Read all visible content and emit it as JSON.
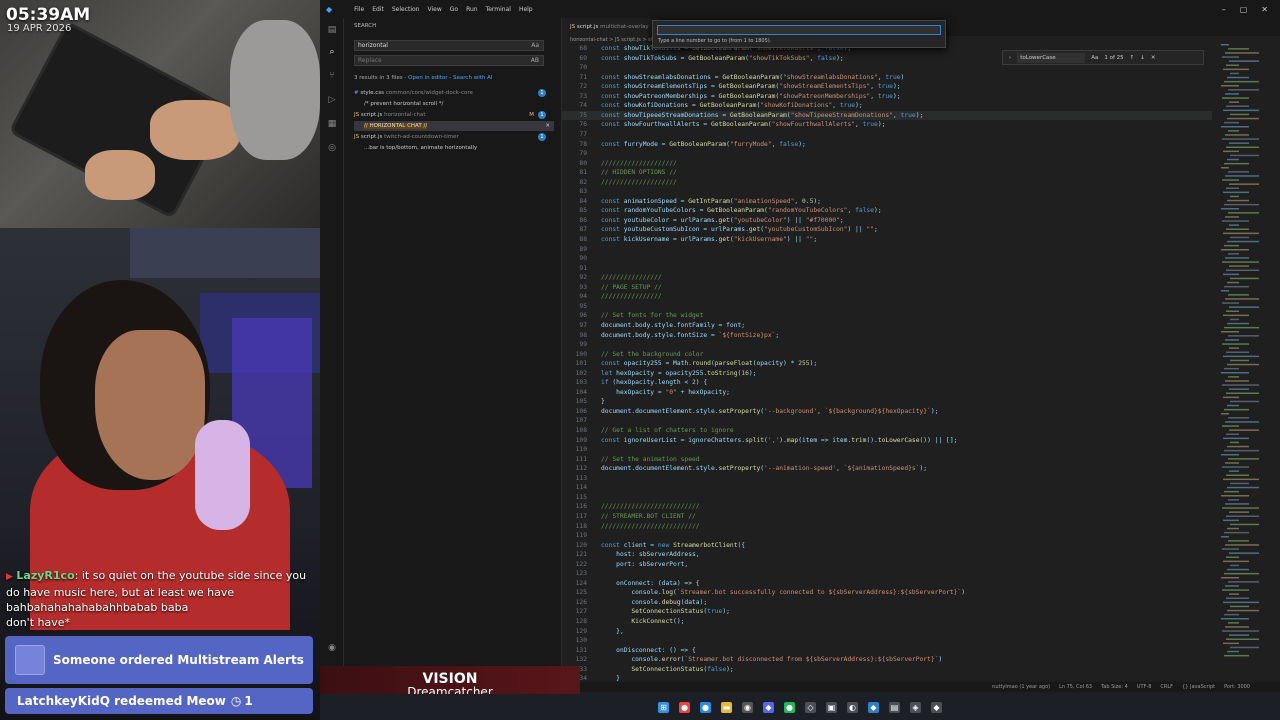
{
  "overlay": {
    "time": "05:39AM",
    "date": "19 APR 2026",
    "chat": {
      "user": "LazyR1co",
      "message": ": it so quiet on the youtube side since you do have music here, but at least we have bahbahahahahabahhbabab baba",
      "message2": "don't have*"
    },
    "alert_order": "Someone ordered Multistream Alerts",
    "alert_redeem": "LatchkeyKidQ redeemed Meow",
    "alert_redeem_count": "1",
    "song_title": "VISION",
    "song_artist": "Dreamcatcher"
  },
  "vscode": {
    "menu": [
      "File",
      "Edit",
      "Selection",
      "View",
      "Go",
      "Run",
      "Terminal",
      "Help"
    ],
    "command_input": "",
    "command_hint": "Type a line number to go to (from 1 to 1805).",
    "search": {
      "title": "SEARCH",
      "query": "horizontal",
      "replace_placeholder": "Replace",
      "case_label": "Aa",
      "preserve_label": "AB",
      "results_text": "3 results in 3 files",
      "open_editor_link": "Open in editor",
      "search_ai_link": "Search with AI",
      "files": [
        {
          "name": "style.css",
          "path": "common/core/widget-dock-core",
          "count": "1",
          "match": "/* prevent horizontal scroll */"
        },
        {
          "name": "script.js",
          "path": "horizontal-chat",
          "count": "1",
          "match": "// HORIZONTAL CHAT //",
          "status": "M"
        },
        {
          "name": "script.js",
          "path": "twitch-ad-countdown-timer",
          "count": "1",
          "match": "...bar is top/bottom, animate horizontally"
        }
      ]
    },
    "tab_label": "script.js",
    "tab_sub": "multichat-overlay",
    "breadcrumb": "horizontal-chat > JS script.js > showTipeeeStreamDonations",
    "find": {
      "query": "toLowerCase",
      "case_label": "Aa",
      "count": "1 of 25"
    },
    "code_lines": [
      {
        "n": "68",
        "t": "const showTikTokGifts = GetBooleanParam(\"showTikTokGifts\", false);"
      },
      {
        "n": "69",
        "t": "const showTikTokSubs = GetBooleanParam(\"showTikTokSubs\", false);"
      },
      {
        "n": "70",
        "t": ""
      },
      {
        "n": "71",
        "t": "const showStreamlabsDonations = GetBooleanParam(\"showStreamlabsDonations\", true)"
      },
      {
        "n": "72",
        "t": "const showStreamElementsTips = GetBooleanParam(\"showStreamElementsTips\", true);"
      },
      {
        "n": "73",
        "t": "const showPatreonMemberships = GetBooleanParam(\"showPatreonMemberships\", true);"
      },
      {
        "n": "74",
        "t": "const showKofiDonations = GetBooleanParam(\"showKofiDonations\", true);"
      },
      {
        "n": "75",
        "t": "const showTipeeeStreamDonations = GetBooleanParam(\"showTipeeeStreamDonations\", true);"
      },
      {
        "n": "76",
        "t": "const showFourthwallAlerts = GetBooleanParam(\"showFourthwallAlerts\", true);"
      },
      {
        "n": "77",
        "t": ""
      },
      {
        "n": "78",
        "t": "const furryMode = GetBooleanParam(\"furryMode\", false);"
      },
      {
        "n": "79",
        "t": ""
      },
      {
        "n": "80",
        "t": "////////////////////"
      },
      {
        "n": "81",
        "t": "// HIDDEN OPTIONS //"
      },
      {
        "n": "82",
        "t": "////////////////////"
      },
      {
        "n": "83",
        "t": ""
      },
      {
        "n": "84",
        "t": "const animationSpeed = GetIntParam(\"animationSpeed\", 0.5);"
      },
      {
        "n": "85",
        "t": "const randomYouTubeColors = GetBooleanParam(\"randomYouTubeColors\", false);"
      },
      {
        "n": "86",
        "t": "const youtubeColor = urlParams.get(\"youtubeColor\") || \"#f70000\";"
      },
      {
        "n": "87",
        "t": "const youtubeCustomSubIcon = urlParams.get(\"youtubeCustomSubIcon\") || \"\";"
      },
      {
        "n": "88",
        "t": "const kickUsername = urlParams.get(\"kickUsername\") || \"\";"
      },
      {
        "n": "89",
        "t": ""
      },
      {
        "n": "90",
        "t": ""
      },
      {
        "n": "91",
        "t": ""
      },
      {
        "n": "92",
        "t": "////////////////"
      },
      {
        "n": "93",
        "t": "// PAGE SETUP //"
      },
      {
        "n": "94",
        "t": "////////////////"
      },
      {
        "n": "95",
        "t": ""
      },
      {
        "n": "96",
        "t": "// Set fonts for the widget"
      },
      {
        "n": "97",
        "t": "document.body.style.fontFamily = font;"
      },
      {
        "n": "98",
        "t": "document.body.style.fontSize = `${fontSize}px`;"
      },
      {
        "n": "99",
        "t": ""
      },
      {
        "n": "100",
        "t": "// Set the background color"
      },
      {
        "n": "101",
        "t": "const opacity255 = Math.round(parseFloat(opacity) * 255);"
      },
      {
        "n": "102",
        "t": "let hexOpacity = opacity255.toString(16);"
      },
      {
        "n": "103",
        "t": "if (hexOpacity.length < 2) {"
      },
      {
        "n": "104",
        "t": "    hexOpacity = \"0\" + hexOpacity;"
      },
      {
        "n": "105",
        "t": "}"
      },
      {
        "n": "106",
        "t": "document.documentElement.style.setProperty('--background', `${background}${hexOpacity}`);"
      },
      {
        "n": "107",
        "t": ""
      },
      {
        "n": "108",
        "t": "// Get a list of chatters to ignore"
      },
      {
        "n": "109",
        "t": "const ignoreUserList = ignoreChatters.split(',').map(item => item.trim().toLowerCase()) || [];"
      },
      {
        "n": "110",
        "t": ""
      },
      {
        "n": "111",
        "t": "// Set the animation speed"
      },
      {
        "n": "112",
        "t": "document.documentElement.style.setProperty('--animation-speed', `${animationSpeed}s`);"
      },
      {
        "n": "113",
        "t": ""
      },
      {
        "n": "114",
        "t": ""
      },
      {
        "n": "115",
        "t": ""
      },
      {
        "n": "116",
        "t": "//////////////////////////"
      },
      {
        "n": "117",
        "t": "// STREAMER.BOT CLIENT //"
      },
      {
        "n": "118",
        "t": "//////////////////////////"
      },
      {
        "n": "119",
        "t": ""
      },
      {
        "n": "120",
        "t": "const client = new StreamerbotClient({"
      },
      {
        "n": "121",
        "t": "    host: sbServerAddress,"
      },
      {
        "n": "122",
        "t": "    port: sbServerPort,"
      },
      {
        "n": "123",
        "t": ""
      },
      {
        "n": "124",
        "t": "    onConnect: (data) => {"
      },
      {
        "n": "125",
        "t": "        console.log(`Streamer.bot successfully connected to ${sbServerAddress}:${sbServerPort}`)"
      },
      {
        "n": "126",
        "t": "        console.debug(data);"
      },
      {
        "n": "127",
        "t": "        SetConnectionStatus(true);"
      },
      {
        "n": "128",
        "t": "        KickConnect();"
      },
      {
        "n": "129",
        "t": "    },"
      },
      {
        "n": "130",
        "t": ""
      },
      {
        "n": "131",
        "t": "    onDisconnect: () => {"
      },
      {
        "n": "132",
        "t": "        console.error(`Streamer.bot disconnected from ${sbServerAddress}:${sbServerPort}`)"
      },
      {
        "n": "133",
        "t": "        SetConnectionStatus(false);"
      },
      {
        "n": "134",
        "t": "    }"
      },
      {
        "n": "135",
        "t": "});"
      }
    ],
    "status": [
      "nuttylmao (1 year ago)",
      "Ln 75, Col 63",
      "Tab Size: 4",
      "UTF-8",
      "CRLF",
      "{} JavaScript",
      "Port: 3000"
    ]
  }
}
